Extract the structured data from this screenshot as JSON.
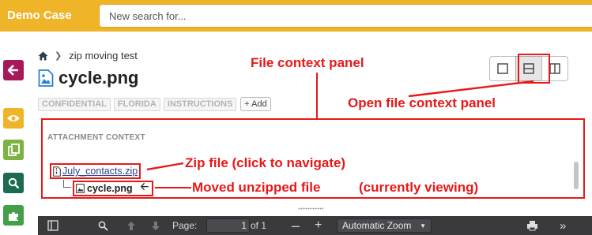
{
  "app": {
    "title": "Demo Case"
  },
  "search": {
    "placeholder": "New search for..."
  },
  "breadcrumb": {
    "parent": "zip moving test"
  },
  "file": {
    "title": "cycle.png"
  },
  "tags": [
    "CONFIDENTIAL",
    "FLORIDA",
    "INSTRUCTIONS"
  ],
  "add_tag_label": "+ Add",
  "attachment_context": {
    "label": "ATTACHMENT CONTEXT",
    "zip_name": "July_contacts.zip",
    "file_name": "cycle.png"
  },
  "viewer": {
    "page_label": "Page:",
    "page_value": "1",
    "page_of": "of 1",
    "zoom": "Automatic Zoom"
  },
  "annotations": {
    "file_context_panel": "File context panel",
    "open_file_context_panel": "Open file context panel",
    "zip_file": "Zip file (click to navigate)",
    "moved_unzipped": "Moved unzipped file",
    "currently_viewing": "(currently viewing)"
  },
  "colors": {
    "topbar": "#f0b429",
    "back_button": "#a8195a",
    "eye_button": "#f0b429",
    "copy_button": "#7cb342",
    "search_button": "#1a6b4f",
    "puzzle_button": "#43a047",
    "annotation_red": "#e81818"
  },
  "icons": {
    "rail": [
      "arrow-left-icon",
      "eye-icon",
      "copy-icon",
      "search-icon",
      "puzzle-icon"
    ],
    "layout": [
      "single-pane-icon",
      "split-horizontal-icon",
      "split-vertical-icon"
    ]
  }
}
